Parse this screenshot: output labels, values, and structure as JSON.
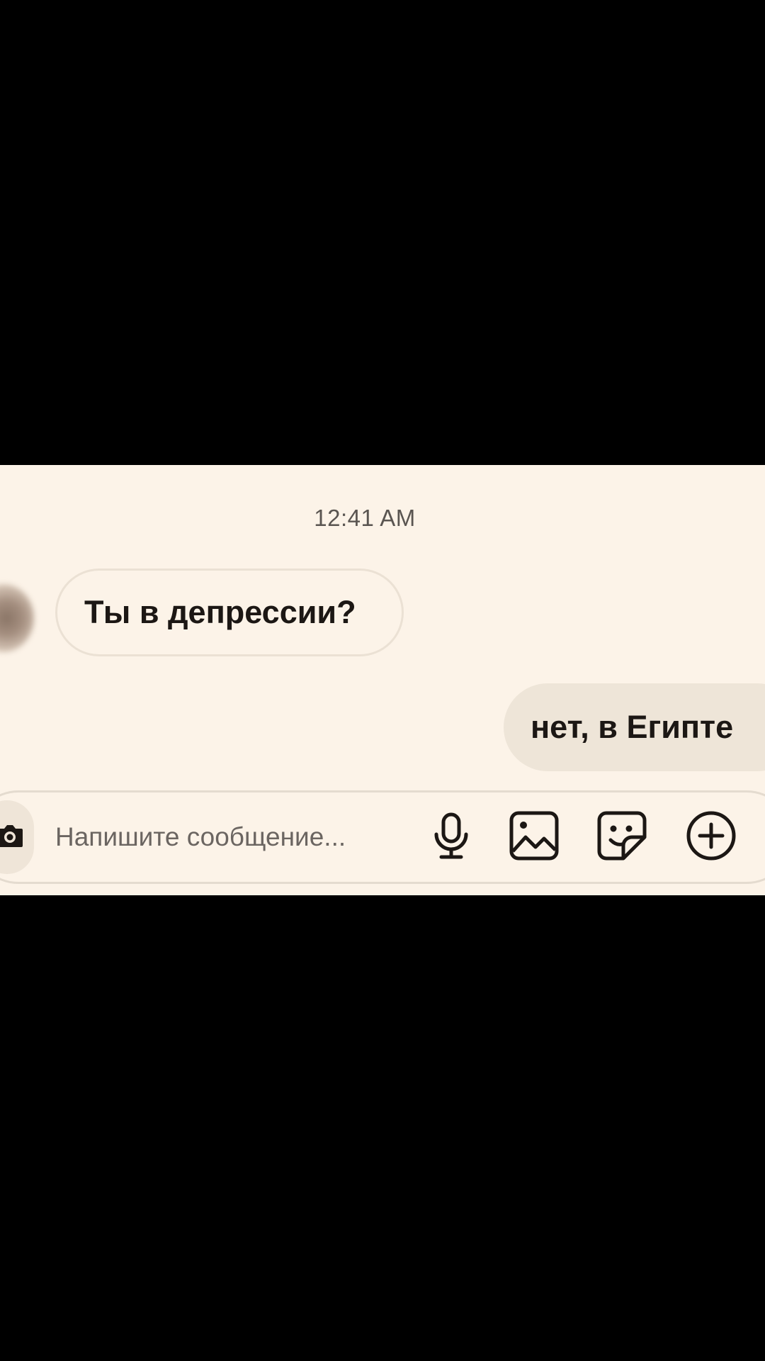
{
  "chat": {
    "timestamp": "12:41 AM",
    "messages": [
      {
        "direction": "incoming",
        "text": "Ты в депрессии?"
      },
      {
        "direction": "outgoing",
        "text": "нет, в Египте"
      }
    ]
  },
  "composer": {
    "placeholder": "Напишите сообщение...",
    "value": "",
    "icons": [
      "camera-icon",
      "microphone-icon",
      "gallery-icon",
      "sticker-icon",
      "plus-icon"
    ]
  },
  "colors": {
    "background": "#fcf3e8",
    "outgoing_bubble": "#eee5d8",
    "text": "#1c1714",
    "letterbox": "#000000"
  }
}
